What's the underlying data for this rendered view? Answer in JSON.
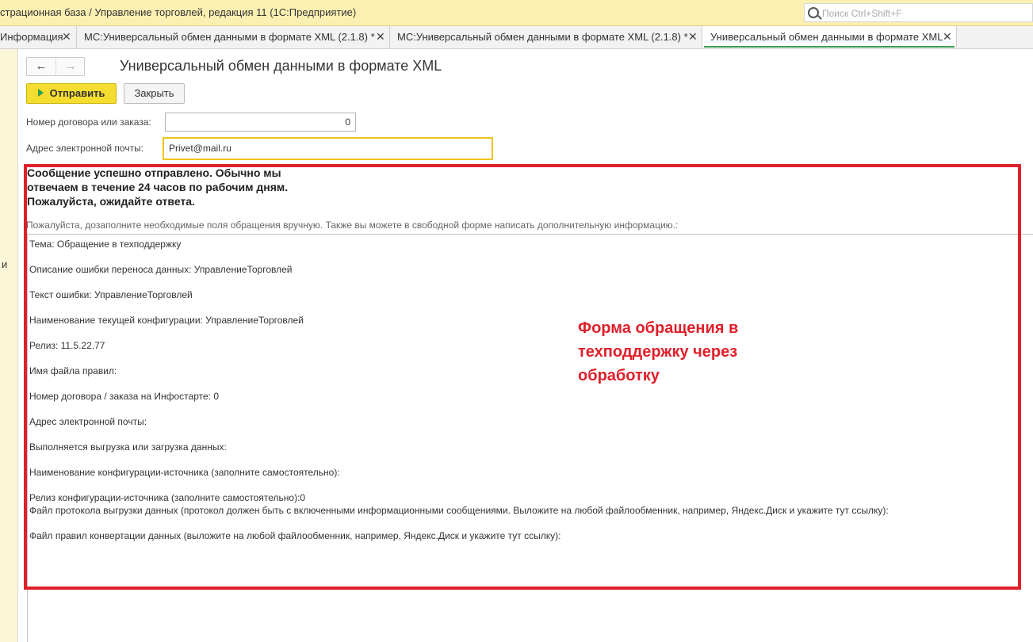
{
  "window": {
    "title": "страционная база / Управление торговлей, редакция 11  (1С:Предприятие)",
    "search_placeholder": "Поиск Ctrl+Shift+F"
  },
  "tabs": [
    {
      "label": "Информация",
      "active": false
    },
    {
      "label": "МС:Универсальный обмен данными в формате XML (2.1.8) *",
      "active": false
    },
    {
      "label": "МС:Универсальный обмен данными в формате XML (2.1.8) *",
      "active": false
    },
    {
      "label": "Универсальный обмен данными в формате XML",
      "active": true
    }
  ],
  "tab_close_glyph": "✕",
  "left_panel_text": "и",
  "form": {
    "title": "Универсальный обмен данными в формате XML",
    "send_label": "Отправить",
    "close_label": "Закрыть",
    "contract_label": "Номер договора или заказа:",
    "contract_value": "0",
    "email_label": "Адрес электронной почты:",
    "email_value": "Privet@mail.ru"
  },
  "message": {
    "head_line1": "Сообщение успешно отправлено. Обычно мы",
    "head_line2": "отвечаем в течение 24 часов по рабочим дням.",
    "head_line3": "Пожалуйста, ожидайте ответа.",
    "hint": "Пожалуйста, дозаполните необходимые поля обращения вручную. Также вы можете в свободной форме написать дополнительную информацию.:"
  },
  "request_lines": [
    "Тема: Обращение в техподдержку",
    "Описание ошибки переноса данных: УправлениеТорговлей",
    "Текст ошибки: УправлениеТорговлей",
    "Наименование текущей конфигурации: УправлениеТорговлей",
    "Релиз: 11.5.22.77",
    "Имя файла правил:",
    "Номер договора / заказа на Инфостарте: 0",
    "Адрес электронной почты:",
    "Выполняется выгрузка или загрузка данных:",
    "Наименование конфигурации-источника (заполните самостоятельно):",
    "Релиз конфигурации-источника (заполните самостоятельно):0",
    "Файл протокола выгрузки данных (протокол должен быть с включенными информационными сообщениями. Выложите на любой файлообменник, например, Яндекс.Диск и укажите тут ссылку):",
    "Файл правил конвертации данных (выложите на любой файлообменник, например, Яндекс.Диск и укажите тут ссылку):"
  ],
  "annotation": {
    "line1": "Форма обращения в",
    "line2": "техподдержку через",
    "line3": "обработку",
    "color": "#e0202a"
  },
  "colors": {
    "title_bar": "#fbf0b2",
    "send_button": "#f5dd2f",
    "active_tab_underline": "#3c9a4f",
    "email_focus_border": "#f0c419"
  }
}
